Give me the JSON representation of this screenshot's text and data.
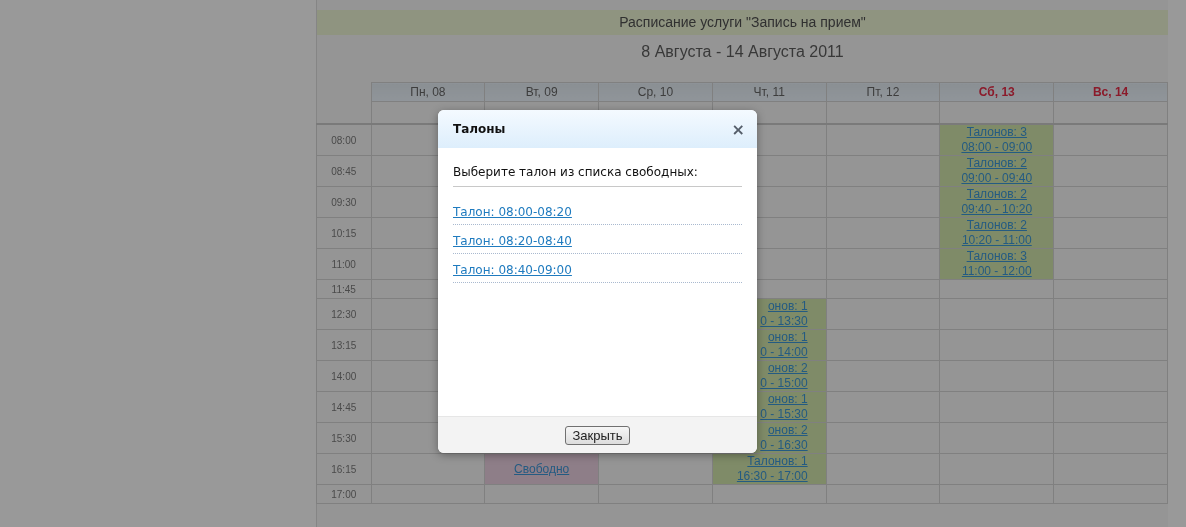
{
  "schedule": {
    "title": "Расписание услуги \"Запись на прием\"",
    "period": "8 Августа - 14 Августа 2011",
    "days": [
      {
        "label": "Пн, 08",
        "weekend": false
      },
      {
        "label": "Вт, 09",
        "weekend": false
      },
      {
        "label": "Ср, 10",
        "weekend": false
      },
      {
        "label": "Чт, 11",
        "weekend": false
      },
      {
        "label": "Пт, 12",
        "weekend": false
      },
      {
        "label": "Сб, 13",
        "weekend": true
      },
      {
        "label": "Вс, 14",
        "weekend": true
      }
    ],
    "rows": [
      {
        "time": "08:00",
        "cells": [
          {
            "kind": "empty"
          },
          {
            "kind": "empty"
          },
          {
            "kind": "empty"
          },
          {
            "kind": "empty"
          },
          {
            "kind": "empty"
          },
          {
            "kind": "slots",
            "lines": [
              "Талонов: 3",
              "08:00 - 09:00"
            ]
          },
          {
            "kind": "empty"
          }
        ]
      },
      {
        "time": "08:45",
        "cells": [
          {
            "kind": "empty"
          },
          {
            "kind": "empty"
          },
          {
            "kind": "empty"
          },
          {
            "kind": "empty"
          },
          {
            "kind": "empty"
          },
          {
            "kind": "slots",
            "lines": [
              "Талонов: 2",
              "09:00 - 09:40"
            ]
          },
          {
            "kind": "empty"
          }
        ]
      },
      {
        "time": "09:30",
        "cells": [
          {
            "kind": "empty"
          },
          {
            "kind": "empty"
          },
          {
            "kind": "empty"
          },
          {
            "kind": "empty"
          },
          {
            "kind": "empty"
          },
          {
            "kind": "slots",
            "lines": [
              "Талонов: 2",
              "09:40 - 10:20"
            ]
          },
          {
            "kind": "empty"
          }
        ]
      },
      {
        "time": "10:15",
        "cells": [
          {
            "kind": "empty"
          },
          {
            "kind": "empty"
          },
          {
            "kind": "empty"
          },
          {
            "kind": "empty"
          },
          {
            "kind": "empty"
          },
          {
            "kind": "slots",
            "lines": [
              "Талонов: 2",
              "10:20 - 11:00"
            ]
          },
          {
            "kind": "empty"
          }
        ]
      },
      {
        "time": "11:00",
        "cells": [
          {
            "kind": "empty"
          },
          {
            "kind": "empty"
          },
          {
            "kind": "empty"
          },
          {
            "kind": "empty"
          },
          {
            "kind": "empty"
          },
          {
            "kind": "slots",
            "lines": [
              "Талонов: 3",
              "11:00 - 12:00"
            ]
          },
          {
            "kind": "empty"
          }
        ]
      },
      {
        "time": "11:45",
        "cells": [
          {
            "kind": "empty"
          },
          {
            "kind": "empty"
          },
          {
            "kind": "empty"
          },
          {
            "kind": "empty"
          },
          {
            "kind": "empty"
          },
          {
            "kind": "empty"
          },
          {
            "kind": "empty"
          }
        ]
      },
      {
        "time": "12:30",
        "cells": [
          {
            "kind": "empty"
          },
          {
            "kind": "empty"
          },
          {
            "kind": "empty"
          },
          {
            "kind": "slots",
            "lines": [
              "онов: 1",
              "0 - 13:30"
            ]
          },
          {
            "kind": "empty"
          },
          {
            "kind": "empty"
          },
          {
            "kind": "empty"
          }
        ]
      },
      {
        "time": "13:15",
        "cells": [
          {
            "kind": "empty"
          },
          {
            "kind": "empty"
          },
          {
            "kind": "empty"
          },
          {
            "kind": "slots",
            "lines": [
              "онов: 1",
              "0 - 14:00"
            ]
          },
          {
            "kind": "empty"
          },
          {
            "kind": "empty"
          },
          {
            "kind": "empty"
          }
        ]
      },
      {
        "time": "14:00",
        "cells": [
          {
            "kind": "empty"
          },
          {
            "kind": "empty"
          },
          {
            "kind": "empty"
          },
          {
            "kind": "slots",
            "lines": [
              "онов: 2",
              "0 - 15:00"
            ]
          },
          {
            "kind": "empty"
          },
          {
            "kind": "empty"
          },
          {
            "kind": "empty"
          }
        ]
      },
      {
        "time": "14:45",
        "cells": [
          {
            "kind": "empty"
          },
          {
            "kind": "empty"
          },
          {
            "kind": "empty"
          },
          {
            "kind": "slots",
            "lines": [
              "онов: 1",
              "0 - 15:30"
            ]
          },
          {
            "kind": "empty"
          },
          {
            "kind": "empty"
          },
          {
            "kind": "empty"
          }
        ]
      },
      {
        "time": "15:30",
        "cells": [
          {
            "kind": "empty"
          },
          {
            "kind": "empty"
          },
          {
            "kind": "empty"
          },
          {
            "kind": "slots",
            "lines": [
              "онов: 2",
              "0 - 16:30"
            ]
          },
          {
            "kind": "empty"
          },
          {
            "kind": "empty"
          },
          {
            "kind": "empty"
          }
        ]
      },
      {
        "time": "16:15",
        "cells": [
          {
            "kind": "empty"
          },
          {
            "kind": "free",
            "lines": [
              "Свободно"
            ]
          },
          {
            "kind": "empty"
          },
          {
            "kind": "slots",
            "lines": [
              "Талонов: 1",
              "16:30 - 17:00"
            ]
          },
          {
            "kind": "empty"
          },
          {
            "kind": "empty"
          },
          {
            "kind": "empty"
          }
        ]
      },
      {
        "time": "17:00",
        "cells": [
          {
            "kind": "empty"
          },
          {
            "kind": "empty"
          },
          {
            "kind": "empty"
          },
          {
            "kind": "empty"
          },
          {
            "kind": "empty"
          },
          {
            "kind": "empty"
          },
          {
            "kind": "empty"
          }
        ]
      }
    ]
  },
  "dialog": {
    "title": "Талоны",
    "close": "×",
    "prompt": "Выберите талон из списка свободных:",
    "tickets": [
      "Талон: 08:00-08:20",
      "Талон: 08:20-08:40",
      "Талон: 08:40-09:00"
    ],
    "button": "Закрыть"
  }
}
